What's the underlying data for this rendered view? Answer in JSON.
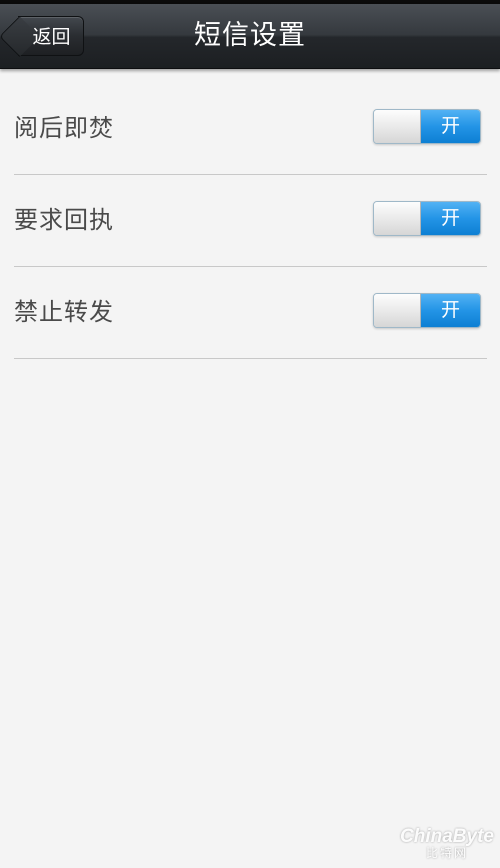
{
  "header": {
    "back_label": "返回",
    "title": "短信设置"
  },
  "settings": [
    {
      "label": "阅后即焚",
      "toggle_label": "开",
      "state": "on"
    },
    {
      "label": "要求回执",
      "toggle_label": "开",
      "state": "on"
    },
    {
      "label": "禁止转发",
      "toggle_label": "开",
      "state": "on"
    }
  ],
  "watermark": {
    "brand": "ChinaByte",
    "sub": "比特网"
  },
  "colors": {
    "header_bg": "#2a2d31",
    "background": "#f4f4f4",
    "toggle_on": "#2394e6",
    "label_text": "#4a4a4a",
    "divider": "#c8c8c8"
  },
  "icons": {
    "back": "back-arrow-icon"
  }
}
